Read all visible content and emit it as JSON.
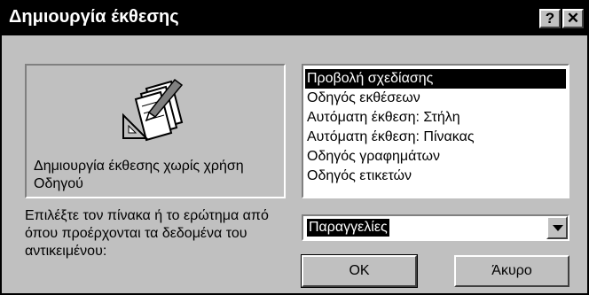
{
  "window": {
    "title": "Δημιουργία έκθεσης",
    "help_label": "?",
    "close_label": "✕"
  },
  "preview": {
    "icon": "report-wizard-icon",
    "description": "Δημιουργία έκθεσης χωρίς χρήση Οδηγού"
  },
  "list": {
    "items": [
      {
        "label": "Προβολή σχεδίασης",
        "selected": true
      },
      {
        "label": "Οδηγός εκθέσεων",
        "selected": false
      },
      {
        "label": "Αυτόματη έκθεση: Στήλη",
        "selected": false
      },
      {
        "label": "Αυτόματη έκθεση: Πίνακας",
        "selected": false
      },
      {
        "label": "Οδηγός γραφημάτων",
        "selected": false
      },
      {
        "label": "Οδηγός ετικετών",
        "selected": false
      }
    ]
  },
  "source": {
    "label": "Επιλέξτε τον πίνακα ή το ερώτημα από όπου προέρχονται τα δεδομένα του αντικειμένου:",
    "selected_value": "Παραγγελίες"
  },
  "buttons": {
    "ok_label": "OK",
    "cancel_label": "Άκυρο"
  },
  "colors": {
    "dialog_face": "#c0c0c0",
    "title_bar": "#000000",
    "selection": "#000000"
  }
}
